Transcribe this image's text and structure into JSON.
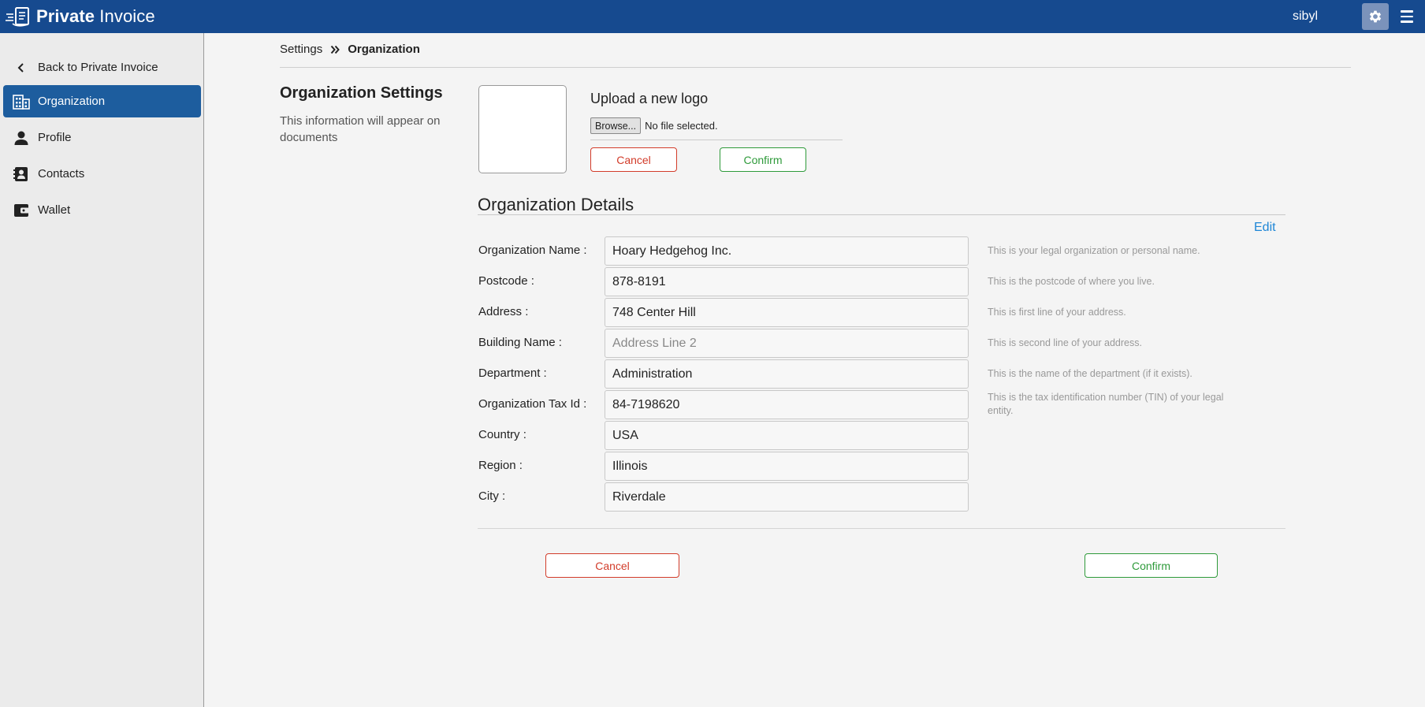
{
  "header": {
    "brand_bold": "Private",
    "brand_rest": " Invoice",
    "username": "sibyl"
  },
  "sidebar": {
    "items": [
      {
        "label": "Back to Private Invoice",
        "icon": "chevron-left-icon"
      },
      {
        "label": "Organization",
        "icon": "building-icon",
        "active": true
      },
      {
        "label": "Profile",
        "icon": "person-icon"
      },
      {
        "label": "Contacts",
        "icon": "contacts-icon"
      },
      {
        "label": "Wallet",
        "icon": "wallet-icon"
      }
    ]
  },
  "breadcrumb": {
    "parent": "Settings",
    "current": "Organization"
  },
  "section": {
    "title": "Organization Settings",
    "description": "This information will appear on documents"
  },
  "logo_upload": {
    "title": "Upload a new logo",
    "browse_label": "Browse...",
    "file_status": "No file selected.",
    "cancel_label": "Cancel",
    "confirm_label": "Confirm"
  },
  "details": {
    "title": "Organization Details",
    "edit_label": "Edit",
    "fields": [
      {
        "label": "Organization Name :",
        "value": "Hoary Hedgehog Inc.",
        "help": "This is your legal organization or personal name."
      },
      {
        "label": "Postcode :",
        "value": "878-8191",
        "help": "This is the postcode of where you live."
      },
      {
        "label": "Address :",
        "value": "748 Center Hill",
        "help": "This is first line of your address."
      },
      {
        "label": "Building Name :",
        "value": "",
        "placeholder": "Address Line 2",
        "help": "This is second line of your address."
      },
      {
        "label": "Department :",
        "value": "Administration",
        "help": "This is the name of the department (if it exists)."
      },
      {
        "label": "Organization Tax Id :",
        "value": "84-7198620",
        "help": "This is the tax identification number (TIN) of your legal entity."
      },
      {
        "label": "Country :",
        "value": "USA",
        "help": ""
      },
      {
        "label": "Region :",
        "value": "Illinois",
        "help": ""
      },
      {
        "label": "City :",
        "value": "Riverdale",
        "help": ""
      }
    ]
  },
  "footer_actions": {
    "cancel_label": "Cancel",
    "confirm_label": "Confirm"
  },
  "colors": {
    "header_bg": "#164a8f",
    "active_nav": "#1d5d9e",
    "cancel": "#d23c2a",
    "confirm": "#2e9a3a",
    "link": "#1e86d6"
  }
}
